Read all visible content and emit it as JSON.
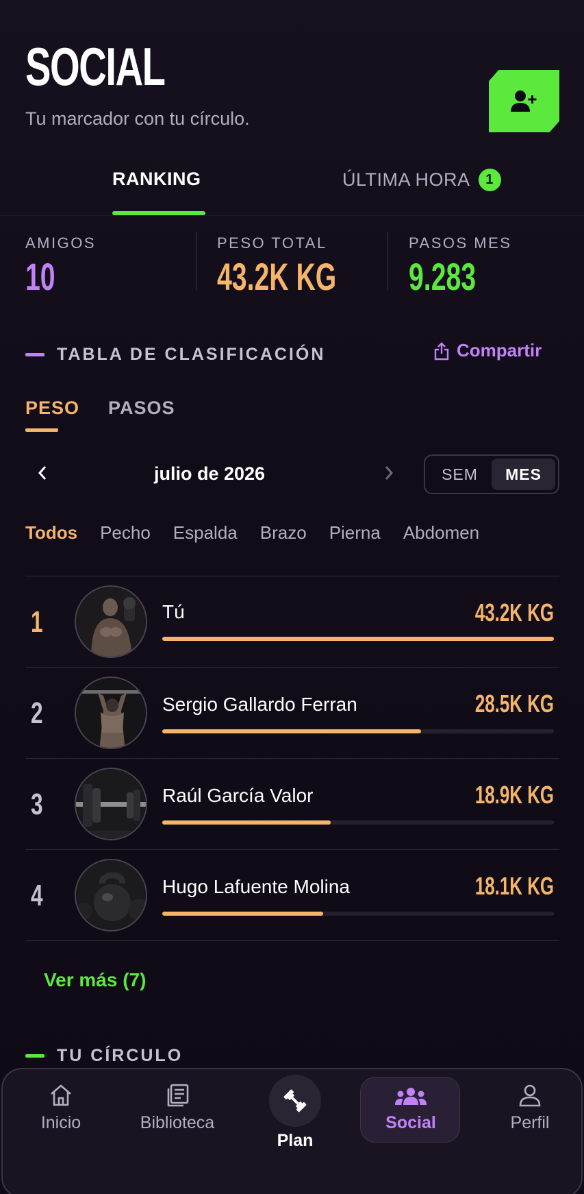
{
  "header": {
    "title": "SOCIAL",
    "subtitle": "Tu marcador con tu círculo."
  },
  "tabs": [
    {
      "label": "RANKING",
      "active": true
    },
    {
      "label": "ÚLTIMA HORA",
      "badge": "1",
      "active": false
    }
  ],
  "stats": [
    {
      "label": "AMIGOS",
      "value": "10",
      "color": "#c182f7"
    },
    {
      "label": "PESO TOTAL",
      "value": "43.2K KG",
      "color": "#f5b56b"
    },
    {
      "label": "PASOS MES",
      "value": "9.283",
      "color": "#5be93e"
    }
  ],
  "leaderboard": {
    "section_title": "TABLA DE CLASIFICACIÓN",
    "share_label": "Compartir",
    "metric_tabs": [
      {
        "label": "PESO",
        "active": true
      },
      {
        "label": "PASOS",
        "active": false
      }
    ],
    "period": "julio de 2026",
    "range_options": [
      {
        "label": "SEM",
        "active": false
      },
      {
        "label": "MES",
        "active": true
      }
    ],
    "filters": [
      {
        "label": "Todos",
        "active": true
      },
      {
        "label": "Pecho",
        "active": false
      },
      {
        "label": "Espalda",
        "active": false
      },
      {
        "label": "Brazo",
        "active": false
      },
      {
        "label": "Pierna",
        "active": false
      },
      {
        "label": "Abdomen",
        "active": false
      }
    ],
    "rows": [
      {
        "rank": "1",
        "name": "Tú",
        "value": "43.2K KG",
        "progress": 1.0,
        "avatar": "flexing-athlete"
      },
      {
        "rank": "2",
        "name": "Sergio Gallardo Ferran",
        "value": "28.5K KG",
        "progress": 0.66,
        "avatar": "back-athlete"
      },
      {
        "rank": "3",
        "name": "Raúl García Valor",
        "value": "18.9K KG",
        "progress": 0.43,
        "avatar": "barbell"
      },
      {
        "rank": "4",
        "name": "Hugo Lafuente Molina",
        "value": "18.1K KG",
        "progress": 0.41,
        "avatar": "kettlebell"
      }
    ],
    "see_more": "Ver más (7)"
  },
  "circle": {
    "section_title": "TU CÍRCULO"
  },
  "nav": [
    {
      "label": "Inicio",
      "icon": "home-icon"
    },
    {
      "label": "Biblioteca",
      "icon": "library-icon"
    },
    {
      "label": "Plan",
      "icon": "dumbbell-icon"
    },
    {
      "label": "Social",
      "icon": "people-icon",
      "active": true
    },
    {
      "label": "Perfil",
      "icon": "user-icon"
    }
  ],
  "colors": {
    "accent_green": "#5be93e",
    "accent_orange": "#f5b56b",
    "accent_purple": "#c182f7",
    "background": "#130e1b"
  }
}
